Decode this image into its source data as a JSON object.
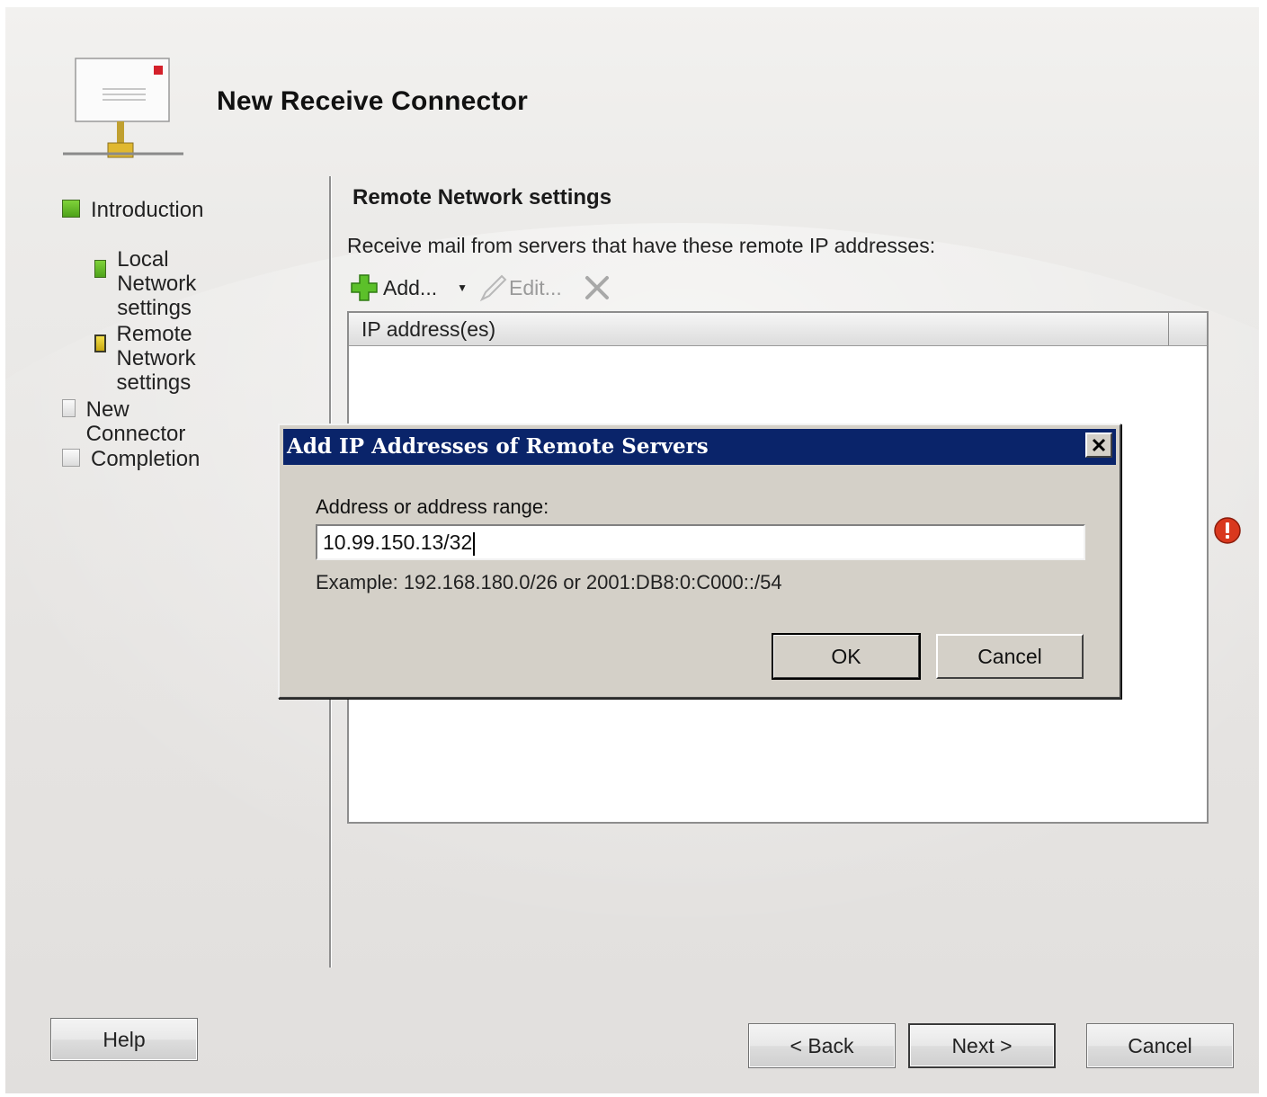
{
  "wizard": {
    "title": "New Receive Connector",
    "steps": [
      {
        "label_line1": "Introduction",
        "label_line2": "",
        "state": "done"
      },
      {
        "label_line1": "Local Network",
        "label_line2": "settings",
        "state": "done"
      },
      {
        "label_line1": "Remote Network",
        "label_line2": "settings",
        "state": "current"
      },
      {
        "label_line1": "New Connector",
        "label_line2": "",
        "state": "pending"
      },
      {
        "label_line1": "Completion",
        "label_line2": "",
        "state": "pending"
      }
    ],
    "section_title": "Remote Network settings",
    "description": "Receive mail from servers that have these remote IP addresses:",
    "toolbar": {
      "add_label": "Add...",
      "edit_label": "Edit..."
    },
    "list": {
      "column_header": "IP address(es)"
    },
    "buttons": {
      "help": "Help",
      "back": "< Back",
      "next": "Next >",
      "cancel": "Cancel"
    }
  },
  "dialog": {
    "title": "Add IP Addresses of Remote Servers",
    "field_label": "Address or address range:",
    "field_value": "10.99.150.13/32",
    "example": "Example: 192.168.180.0/26 or 2001:DB8:0:C000::/54",
    "ok_label": "OK",
    "cancel_label": "Cancel"
  },
  "colors": {
    "dialog_title_bar": "#0a246a",
    "step_done": "#5bb22a",
    "step_current": "#e2c62a",
    "error": "#d9381e"
  }
}
